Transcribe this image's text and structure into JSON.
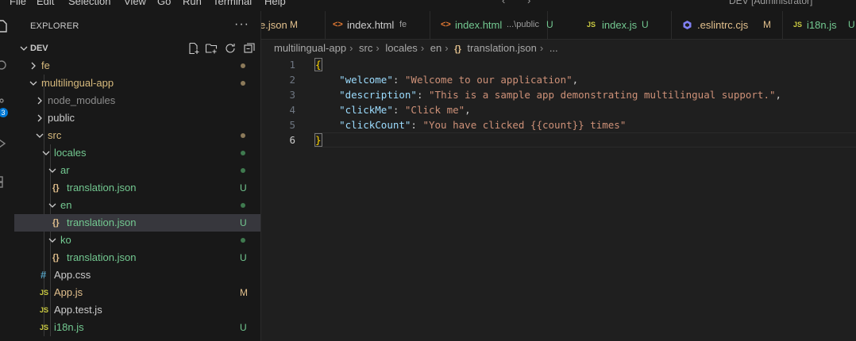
{
  "menu": {
    "items": [
      "File",
      "Edit",
      "Selection",
      "View",
      "Go",
      "Run",
      "Terminal",
      "Help"
    ],
    "window_title": "DEV [Administrator]"
  },
  "activity": {
    "badge": "3"
  },
  "explorer": {
    "title": "EXPLORER",
    "more": "···",
    "root": "DEV",
    "rows": [
      {
        "label": "fe",
        "kind": "folder",
        "open": false,
        "depth": 1,
        "color": "#d7ba7d",
        "dot": "#8c7a5a"
      },
      {
        "label": "multilingual-app",
        "kind": "folder",
        "open": true,
        "depth": 1,
        "color": "#d7ba7d",
        "dot": "#8c7a5a"
      },
      {
        "label": "node_modules",
        "kind": "folder",
        "open": false,
        "depth": 2,
        "color": "#8c8c8c"
      },
      {
        "label": "public",
        "kind": "folder",
        "open": false,
        "depth": 2,
        "color": "#cccccc"
      },
      {
        "label": "src",
        "kind": "folder",
        "open": true,
        "depth": 2,
        "color": "#d7ba7d",
        "dot": "#8c7a5a"
      },
      {
        "label": "locales",
        "kind": "folder",
        "open": true,
        "depth": 3,
        "color": "#73c991",
        "dot": "#3f7a4f"
      },
      {
        "label": "ar",
        "kind": "folder",
        "open": true,
        "depth": 4,
        "color": "#73c991",
        "dot": "#3f7a4f"
      },
      {
        "label": "translation.json",
        "kind": "json",
        "depth": 5,
        "color": "#73c991",
        "status": "U",
        "status_color": "#73c991"
      },
      {
        "label": "en",
        "kind": "folder",
        "open": true,
        "depth": 4,
        "color": "#73c991",
        "dot": "#3f7a4f"
      },
      {
        "label": "translation.json",
        "kind": "json",
        "depth": 5,
        "color": "#73c991",
        "status": "U",
        "status_color": "#73c991",
        "selected": true
      },
      {
        "label": "ko",
        "kind": "folder",
        "open": true,
        "depth": 4,
        "color": "#73c991",
        "dot": "#3f7a4f"
      },
      {
        "label": "translation.json",
        "kind": "json",
        "depth": 5,
        "color": "#73c991",
        "status": "U",
        "status_color": "#73c991"
      },
      {
        "label": "App.css",
        "kind": "css",
        "depth": 4,
        "color": "#cccccc"
      },
      {
        "label": "App.js",
        "kind": "js",
        "depth": 4,
        "color": "#e2c08d",
        "status": "M",
        "status_color": "#e2c08d"
      },
      {
        "label": "App.test.js",
        "kind": "js",
        "depth": 4,
        "color": "#cccccc"
      },
      {
        "label": "i18n.js",
        "kind": "js",
        "depth": 4,
        "color": "#73c991",
        "status": "U",
        "status_color": "#73c991"
      }
    ]
  },
  "tabs": [
    {
      "label": "e.json",
      "status": "M",
      "color": "#e2c08d",
      "icon": "",
      "desc": ""
    },
    {
      "label": "index.html",
      "desc": "fe",
      "icon": "<>",
      "icon_color": "#e37933",
      "color": "#cccccc",
      "status": ""
    },
    {
      "label": "index.html",
      "desc": "...\\public",
      "icon": "<>",
      "icon_color": "#e37933",
      "color": "#73c991",
      "status": "U"
    },
    {
      "label": "index.js",
      "desc": "",
      "icon": "JS",
      "icon_color": "#cbcb41",
      "color": "#73c991",
      "status": "U"
    },
    {
      "label": ".eslintrc.cjs",
      "desc": "",
      "icon": "eslint",
      "icon_color": "#8080f2",
      "color": "#e2c08d",
      "status": "M"
    },
    {
      "label": "i18n.js",
      "desc": "",
      "icon": "JS",
      "icon_color": "#cbcb41",
      "color": "#73c991",
      "status": "U"
    }
  ],
  "breadcrumb": [
    "multilingual-app",
    "src",
    "locales",
    "en",
    "translation.json",
    "..."
  ],
  "editor": {
    "line_numbers": [
      "1",
      "2",
      "3",
      "4",
      "5",
      "6"
    ],
    "entries": [
      {
        "key": "\"welcome\"",
        "value": "\"Welcome to our application\"",
        "comma": ","
      },
      {
        "key": "\"description\"",
        "value": "\"This is a sample app demonstrating multilingual support.\"",
        "comma": ","
      },
      {
        "key": "\"clickMe\"",
        "value": "\"Click me\"",
        "comma": ","
      },
      {
        "key": "\"clickCount\"",
        "value": "\"You have clicked {{count}} times\"",
        "comma": ""
      }
    ],
    "open_brace": "{",
    "close_brace": "}"
  }
}
